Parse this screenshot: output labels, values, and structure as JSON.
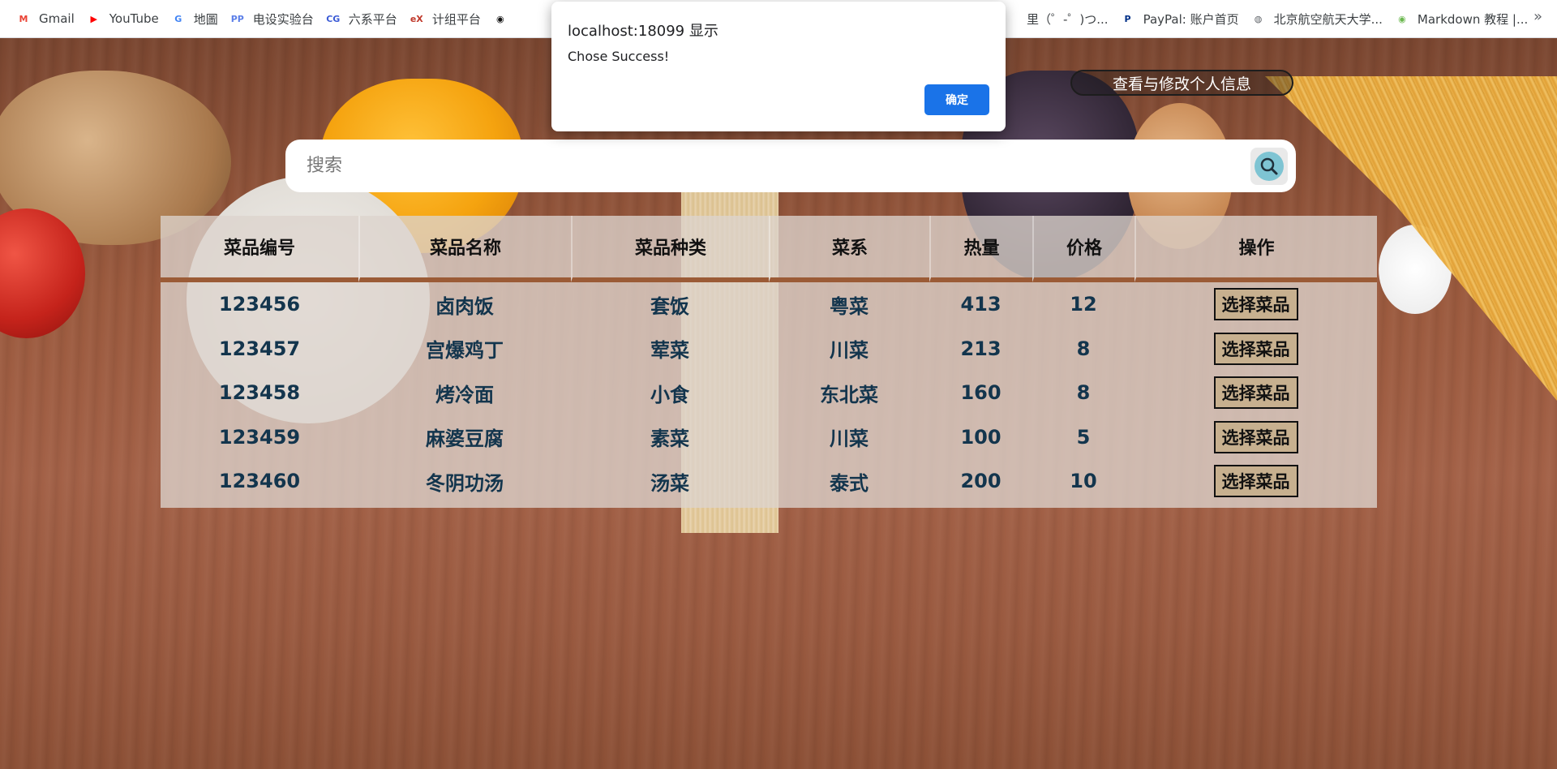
{
  "bookmarks": [
    {
      "label": "Gmail",
      "icon": "gmail-icon",
      "color": "#ea4335",
      "glyph": "M"
    },
    {
      "label": "YouTube",
      "icon": "youtube-icon",
      "color": "#ff0000",
      "glyph": "▶"
    },
    {
      "label": "地圖",
      "icon": "google-icon",
      "color": "#4285f4",
      "glyph": "G"
    },
    {
      "label": "电设实验台",
      "icon": "lab-icon",
      "color": "#5b7fe8",
      "glyph": "PP"
    },
    {
      "label": "六系平台",
      "icon": "cg-icon",
      "color": "#3b5bd6",
      "glyph": "CG"
    },
    {
      "label": "计组平台",
      "icon": "edx-icon",
      "color": "#c0392b",
      "glyph": "eX"
    },
    {
      "label": "",
      "icon": "bookmark-icon",
      "color": "#111111",
      "glyph": "◉"
    }
  ],
  "bookmarks_right": [
    {
      "label": "里（゜-゜)つ...",
      "icon": "bilibili-icon",
      "color": "#555555",
      "glyph": ""
    },
    {
      "label": "PayPal: 账户首页",
      "icon": "paypal-icon",
      "color": "#003087",
      "glyph": "P"
    },
    {
      "label": "北京航空航天大学...",
      "icon": "globe-icon",
      "color": "#5f6368",
      "glyph": "◍"
    },
    {
      "label": "Markdown 教程 |...",
      "icon": "markdown-icon",
      "color": "#6bb84f",
      "glyph": "◉"
    }
  ],
  "bookmarks_more": "»",
  "profile_button": "查看与修改个人信息",
  "search": {
    "placeholder": "搜索"
  },
  "table": {
    "headers": [
      "菜品编号",
      "菜品名称",
      "菜品种类",
      "菜系",
      "热量",
      "价格",
      "操作"
    ],
    "rows": [
      {
        "id": "123456",
        "name": "卤肉饭",
        "type": "套饭",
        "cuisine": "粤菜",
        "calories": "413",
        "price": "12",
        "action": "选择菜品"
      },
      {
        "id": "123457",
        "name": "宫爆鸡丁",
        "type": "荤菜",
        "cuisine": "川菜",
        "calories": "213",
        "price": "8",
        "action": "选择菜品"
      },
      {
        "id": "123458",
        "name": "烤冷面",
        "type": "小食",
        "cuisine": "东北菜",
        "calories": "160",
        "price": "8",
        "action": "选择菜品"
      },
      {
        "id": "123459",
        "name": "麻婆豆腐",
        "type": "素菜",
        "cuisine": "川菜",
        "calories": "100",
        "price": "5",
        "action": "选择菜品"
      },
      {
        "id": "123460",
        "name": "冬阴功汤",
        "type": "汤菜",
        "cuisine": "泰式",
        "calories": "200",
        "price": "10",
        "action": "选择菜品"
      }
    ]
  },
  "dialog": {
    "title": "localhost:18099 显示",
    "message": "Chose Success!",
    "ok_label": "确定"
  }
}
